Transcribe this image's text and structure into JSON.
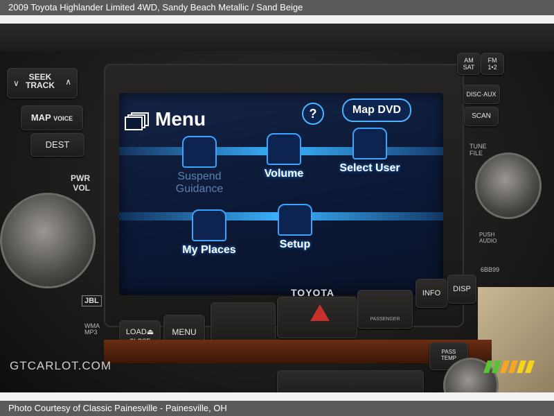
{
  "header": {
    "title": "2009 Toyota Highlander Limited 4WD,  Sandy Beach Metallic / Sand Beige"
  },
  "footer": {
    "credit": "Photo Courtesy of Classic Painesville - Painesville, OH"
  },
  "watermark": {
    "text": "GTCARLOT.COM"
  },
  "screen": {
    "title": "Menu",
    "help_label": "?",
    "map_dvd_label": "Map DVD",
    "tiles": [
      {
        "label_line1": "Suspend",
        "label_line2": "Guidance",
        "icon": "suspend-guidance-icon",
        "enabled": false
      },
      {
        "label_line1": "Volume",
        "label_line2": "",
        "icon": "speaker-icon",
        "enabled": true
      },
      {
        "label_line1": "Select User",
        "label_line2": "",
        "icon": "user-clipboard-icon",
        "enabled": true
      },
      {
        "label_line1": "My Places",
        "label_line2": "",
        "icon": "flag-icon",
        "enabled": true
      },
      {
        "label_line1": "Setup",
        "label_line2": "",
        "icon": "setup-icon",
        "enabled": true
      }
    ],
    "accent": "#3ab2ff"
  },
  "console": {
    "brand": "TOYOTA",
    "seek_track": {
      "line1": "SEEK",
      "line2": "TRACK"
    },
    "map_voice": {
      "main": "MAP",
      "sub": "VOICE"
    },
    "dest": "DEST",
    "pwr_vol": {
      "line1": "PWR",
      "line2": "VOL"
    },
    "am_sat": {
      "line1": "AM",
      "line2": "SAT"
    },
    "fm": {
      "line1": "FM",
      "line2": "1•2"
    },
    "disc_aux": "DISC·AUX",
    "scan": "SCAN",
    "tune_file": {
      "line1": "TUNE",
      "line2": "FILE"
    },
    "push_audio": {
      "line1": "PUSH",
      "line2": "AUDIO"
    },
    "info": "INFO",
    "disp": "DISP",
    "passenger": "PASSENGER",
    "load_close": {
      "line1": "LOAD⏏",
      "line2": "CLOSE"
    },
    "menu": "MENU",
    "jbl": "JBL",
    "wma_mp3": {
      "line1": "WMA",
      "line2": "MP3"
    },
    "pass_temp": {
      "line1": "PASS",
      "line2": "TEMP"
    },
    "code_label": "6BB99"
  }
}
